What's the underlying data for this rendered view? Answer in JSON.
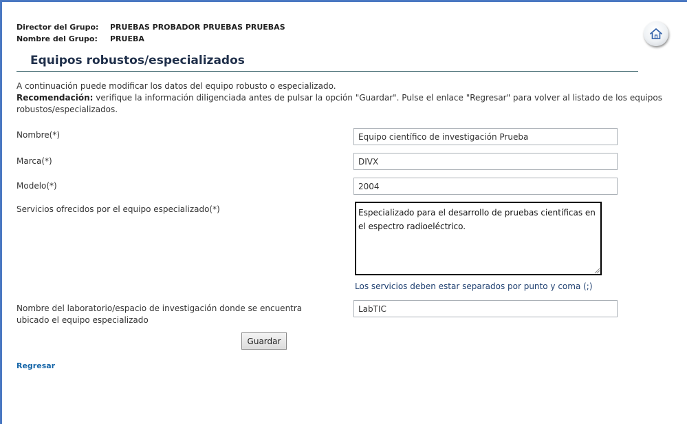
{
  "header": {
    "director_label": "Director del Grupo:",
    "director_value": "PRUEBAS PROBADOR PRUEBAS PRUEBAS",
    "group_label": "Nombre del Grupo:",
    "group_value": "PRUEBA"
  },
  "page": {
    "title": "Equipos robustos/especializados",
    "intro_line": "A continuación puede modificar los datos del equipo robusto o especializado.",
    "recommendation_label": "Recomendación:",
    "recommendation_text": " verifique la información diligenciada antes de pulsar la opción \"Guardar\". Pulse el enlace \"Regresar\" para volver al listado de los equipos robustos/especializados."
  },
  "form": {
    "nombre_label": "Nombre(*)",
    "nombre_value": "Equipo científico de investigación Prueba",
    "marca_label": "Marca(*)",
    "marca_value": "DIVX",
    "modelo_label": "Modelo(*)",
    "modelo_value": "2004",
    "servicios_label": "Servicios ofrecidos por el equipo especializado(*)",
    "servicios_value": "Especializado para el desarrollo de pruebas científicas en el espectro radioeléctrico.",
    "servicios_hint": "Los servicios deben estar separados por punto y coma (;)",
    "laboratorio_label": "Nombre del laboratorio/espacio de investigación donde se encuentra ubicado el equipo especializado",
    "laboratorio_value": "LabTIC",
    "save_label": "Guardar"
  },
  "nav": {
    "back_label": "Regresar"
  },
  "icons": {
    "home": "home-icon"
  },
  "colors": {
    "frame_border": "#4a78c2",
    "title": "#1f2f4a",
    "rule": "#1f4f57",
    "link": "#1565a8",
    "hint": "#1e3f70"
  }
}
